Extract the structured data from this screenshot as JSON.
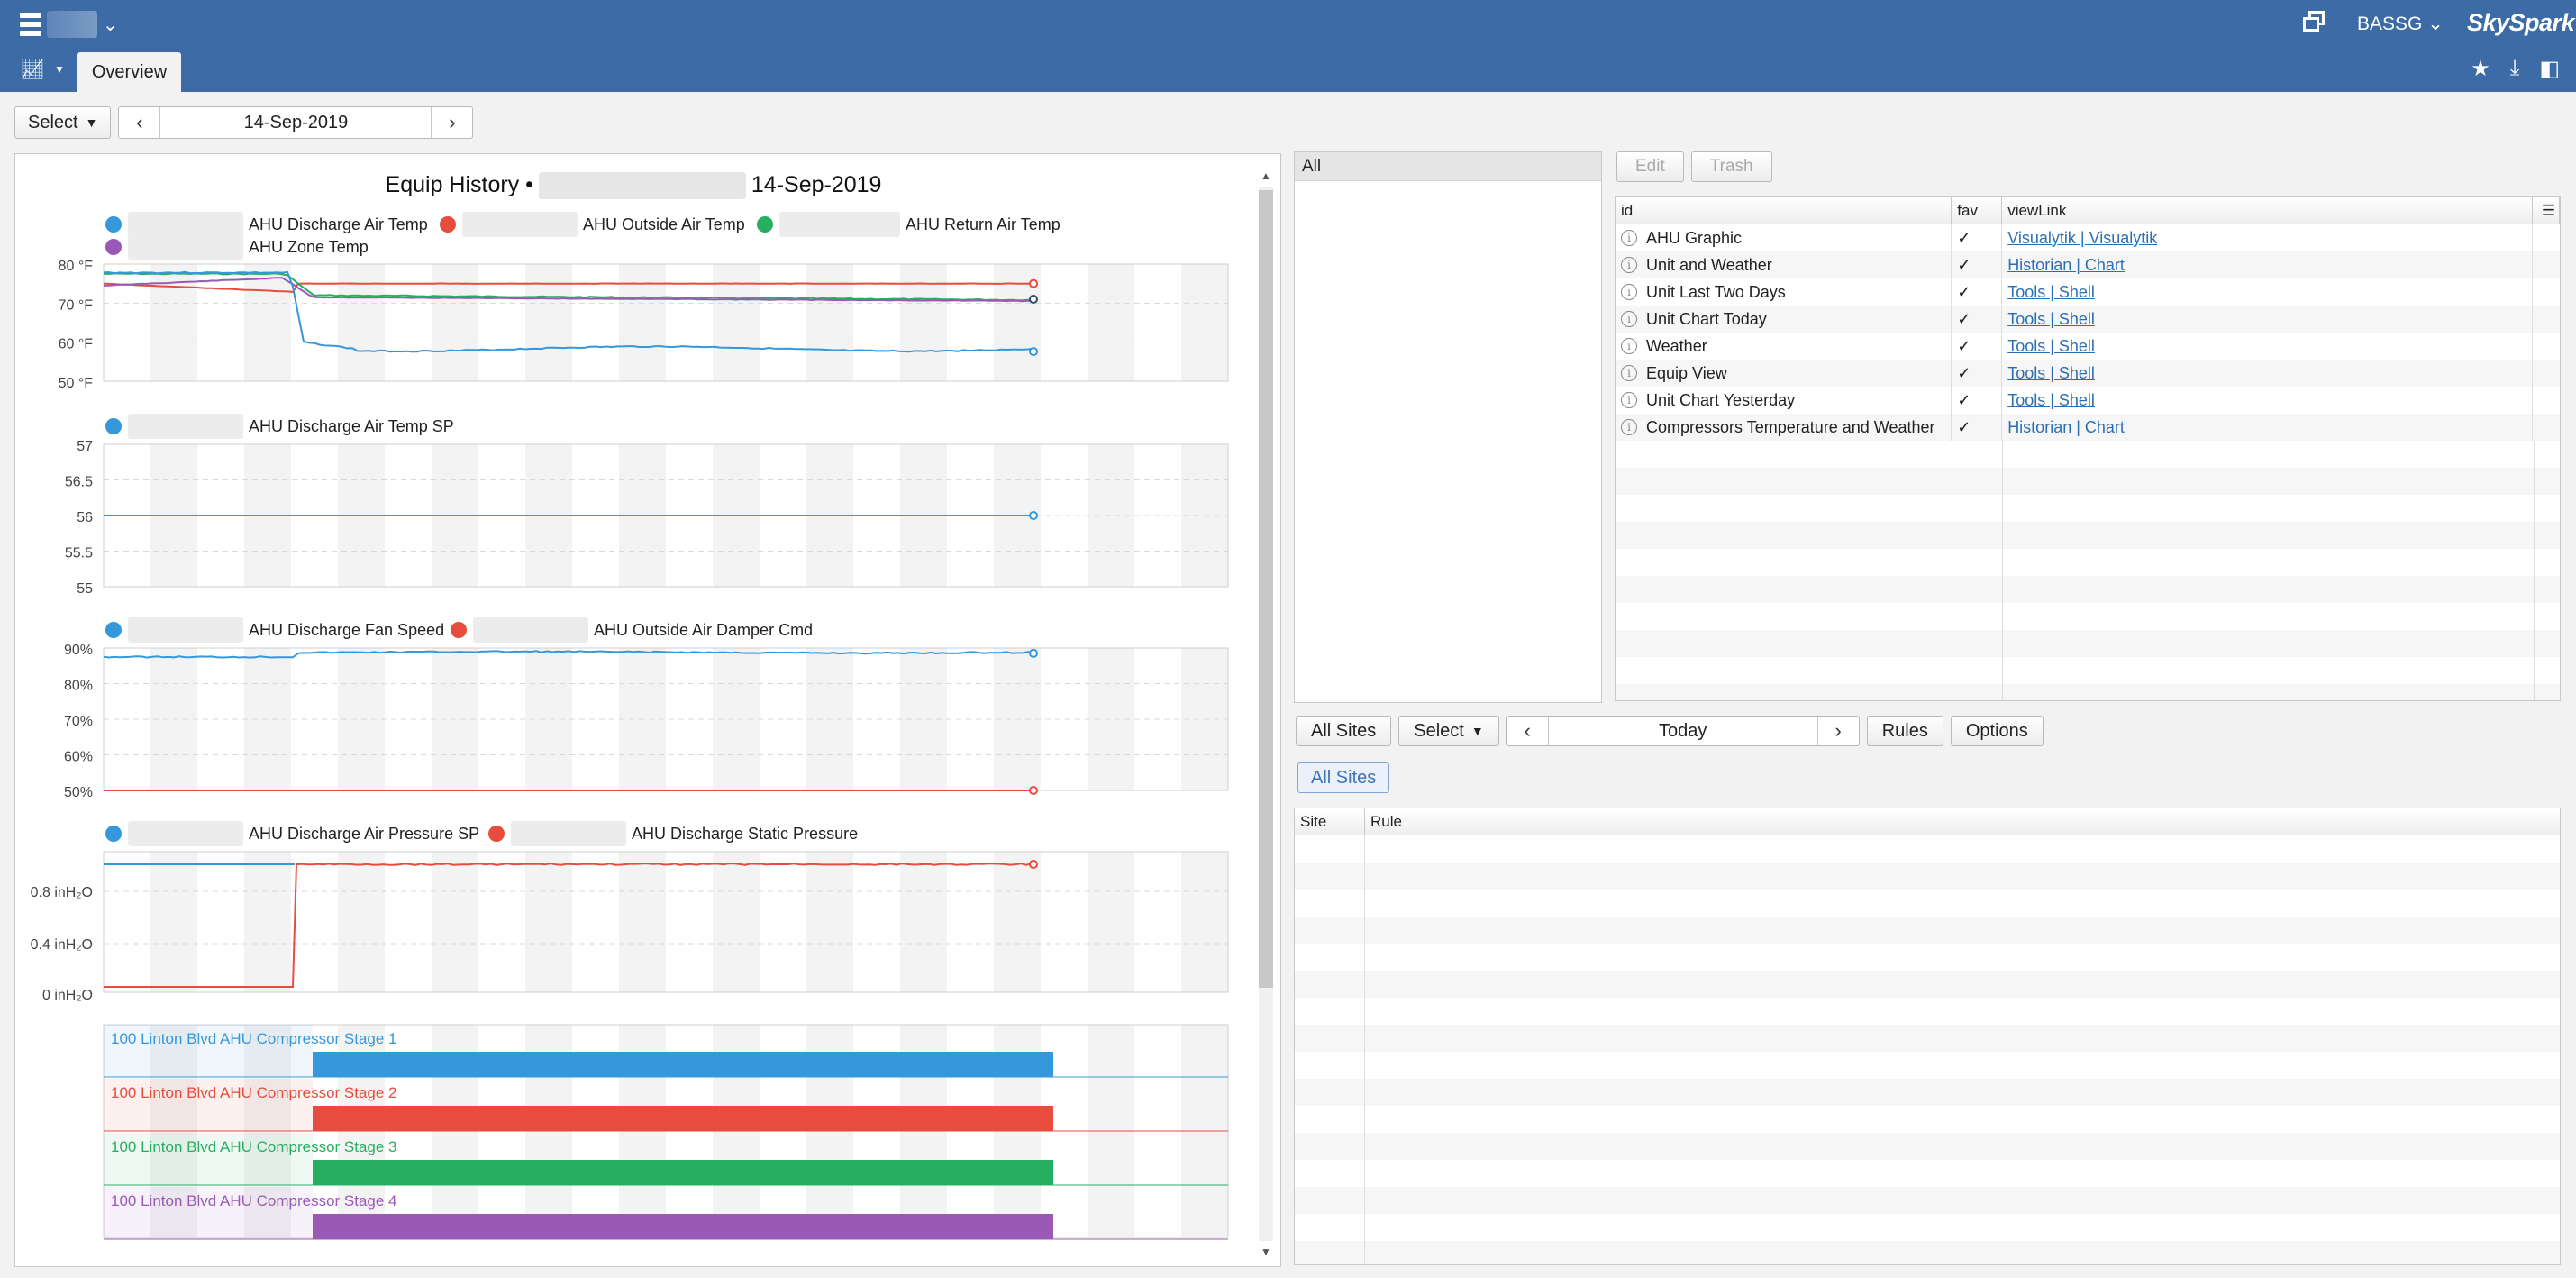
{
  "header": {
    "user": "BASSG",
    "brand": "SkySpark",
    "tab": "Overview"
  },
  "toolbar": {
    "select_label": "Select",
    "date": "14-Sep-2019"
  },
  "chart": {
    "title_prefix": "Equip History •",
    "title_date": "14-Sep-2019"
  },
  "chart_data": [
    {
      "type": "line",
      "title": "",
      "series": [
        {
          "name": "AHU Discharge Air Temp",
          "color": "#3498db"
        },
        {
          "name": "AHU Outside Air Temp",
          "color": "#e74c3c"
        },
        {
          "name": "AHU Return Air Temp",
          "color": "#27ae60"
        },
        {
          "name": "AHU Zone Temp",
          "color": "#9b59b6"
        }
      ],
      "y_ticks": [
        "80 °F",
        "70 °F",
        "60 °F",
        "50 °F"
      ],
      "ylim": [
        50,
        80
      ]
    },
    {
      "type": "line",
      "series": [
        {
          "name": "AHU Discharge Air Temp SP",
          "color": "#3498db"
        }
      ],
      "y_ticks": [
        "57",
        "56.5",
        "56",
        "55.5",
        "55"
      ],
      "ylim": [
        55,
        57
      ]
    },
    {
      "type": "line",
      "series": [
        {
          "name": "AHU Discharge Fan Speed",
          "color": "#3498db"
        },
        {
          "name": "AHU Outside Air Damper Cmd",
          "color": "#e74c3c"
        }
      ],
      "y_ticks": [
        "90%",
        "80%",
        "70%",
        "60%",
        "50%"
      ],
      "ylim": [
        50,
        90
      ]
    },
    {
      "type": "line",
      "series": [
        {
          "name": "AHU Discharge Air Pressure SP",
          "color": "#3498db"
        },
        {
          "name": "AHU Discharge Static Pressure",
          "color": "#e74c3c"
        }
      ],
      "y_ticks": [
        "0.8 inH₂O",
        "0.4 inH₂O",
        "0 inH₂O"
      ]
    },
    {
      "type": "bar",
      "series": [
        {
          "name": "100 Linton Blvd AHU Compressor Stage 1",
          "color": "#3498db"
        },
        {
          "name": "100 Linton Blvd AHU Compressor Stage 2",
          "color": "#e74c3c"
        },
        {
          "name": "100 Linton Blvd AHU Compressor Stage 3",
          "color": "#27ae60"
        },
        {
          "name": "100 Linton Blvd AHU Compressor Stage 4",
          "color": "#9b59b6"
        }
      ]
    }
  ],
  "filter": {
    "all_label": "All"
  },
  "views": {
    "edit_label": "Edit",
    "trash_label": "Trash",
    "columns": [
      "id",
      "fav",
      "viewLink"
    ],
    "rows": [
      {
        "id": "AHU Graphic",
        "fav": "✓",
        "link": "Visualytik | Visualytik"
      },
      {
        "id": "Unit and Weather",
        "fav": "✓",
        "link": "Historian | Chart"
      },
      {
        "id": "Unit Last Two Days",
        "fav": "✓",
        "link": "Tools | Shell"
      },
      {
        "id": "Unit Chart Today",
        "fav": "✓",
        "link": "Tools | Shell"
      },
      {
        "id": "Weather",
        "fav": "✓",
        "link": "Tools | Shell"
      },
      {
        "id": "Equip View",
        "fav": "✓",
        "link": "Tools | Shell"
      },
      {
        "id": "Unit Chart Yesterday",
        "fav": "✓",
        "link": "Tools | Shell"
      },
      {
        "id": "Compressors Temperature and Weather",
        "fav": "✓",
        "link": "Historian | Chart"
      }
    ]
  },
  "rules": {
    "all_sites_label": "All Sites",
    "select_label": "Select",
    "date": "Today",
    "rules_label": "Rules",
    "options_label": "Options",
    "chip_label": "All Sites",
    "columns": [
      "Site",
      "Rule"
    ]
  }
}
